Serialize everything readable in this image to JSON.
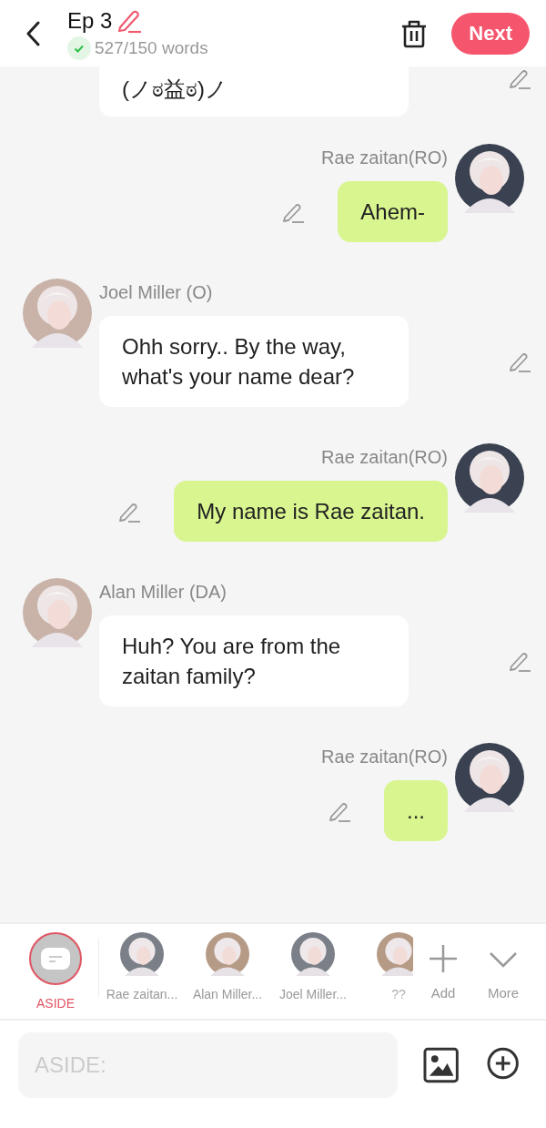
{
  "header": {
    "title": "Ep 3",
    "word_count": "527/150 words",
    "goal_met": true,
    "next_button": "Next"
  },
  "messages": [
    {
      "kind": "left",
      "text": "(ノಠ益ಠ)ノ",
      "avatar": false,
      "clipped": true
    },
    {
      "kind": "right",
      "name": "Rae zaitan(RO)",
      "text": "Ahem-",
      "avatar": true
    },
    {
      "kind": "left",
      "name": "Joel Miller (O)",
      "text": "Ohh sorry.. By the way, what's your name dear?",
      "avatar": true
    },
    {
      "kind": "right",
      "name": "Rae zaitan(RO)",
      "text": "My name is Rae zaitan.",
      "avatar": true
    },
    {
      "kind": "left",
      "name": "Alan Miller (DA)",
      "text": "Huh? You are from the zaitan family?",
      "avatar": true
    },
    {
      "kind": "right",
      "name": "Rae zaitan(RO)",
      "text": "...",
      "avatar": true
    }
  ],
  "characters": [
    {
      "kind": "aside",
      "label": "ASIDE",
      "selected": true
    },
    {
      "kind": "avatar",
      "label": "Rae zaitan...",
      "selected": false
    },
    {
      "kind": "avatar",
      "label": "Alan Miller...",
      "selected": false
    },
    {
      "kind": "avatar",
      "label": "Joel Miller...",
      "selected": false
    },
    {
      "kind": "avatar",
      "label": "??",
      "selected": false
    }
  ],
  "actions": [
    {
      "kind": "add",
      "label": "Add"
    },
    {
      "kind": "more",
      "label": "More"
    }
  ],
  "composer": {
    "placeholder": "ASIDE:"
  }
}
